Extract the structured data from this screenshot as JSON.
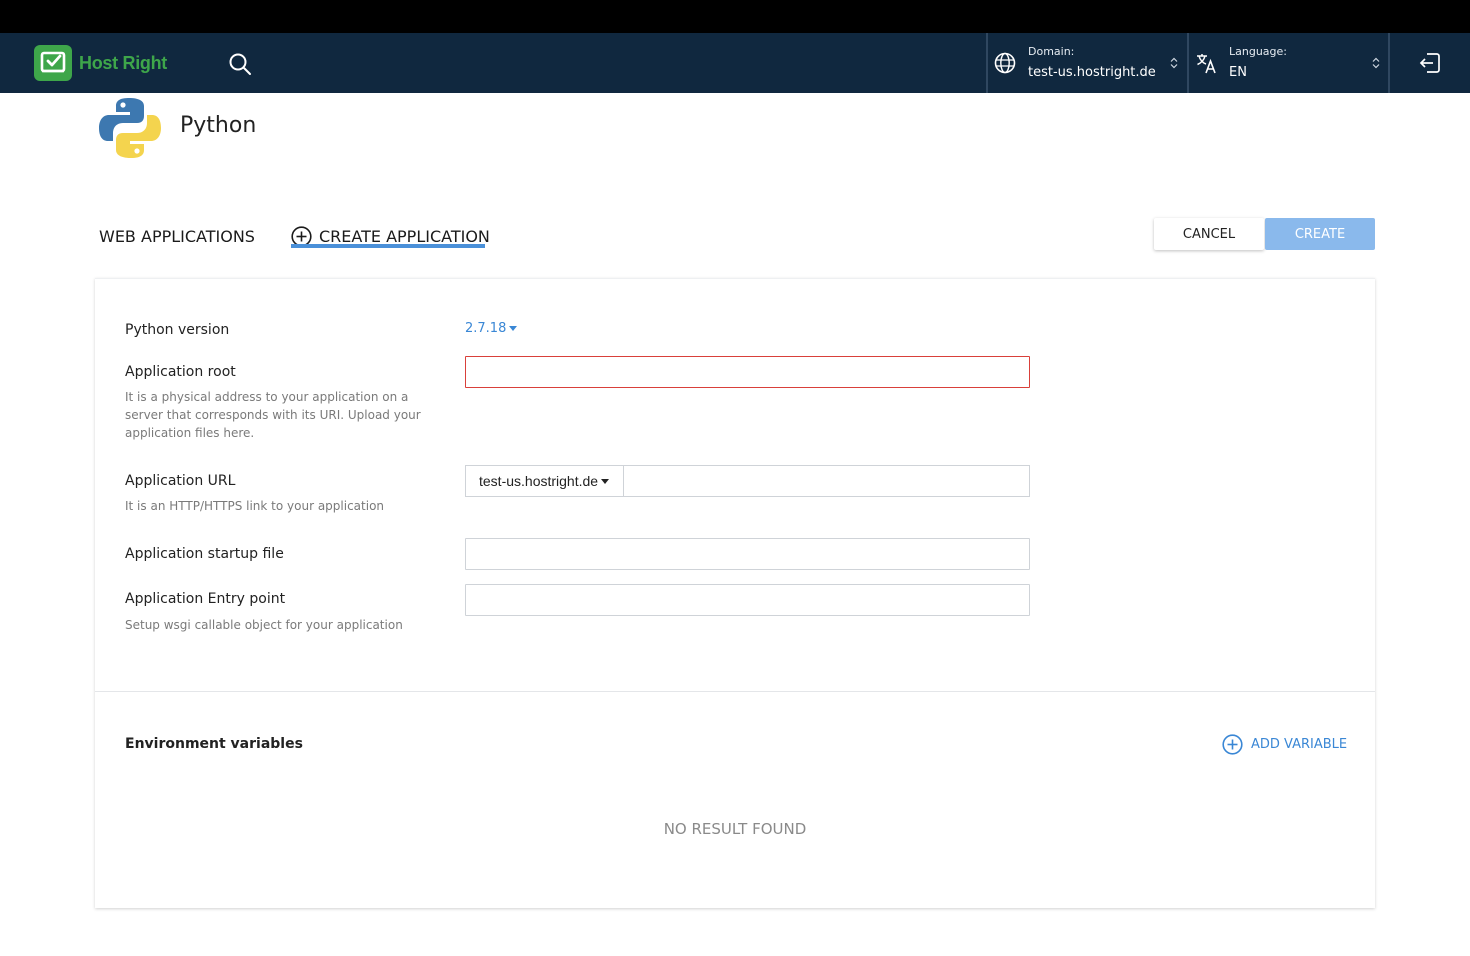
{
  "colors": {
    "navbar": "#10283f",
    "brand_green": "#3ea64a",
    "accent_blue": "#3a87d5",
    "create_button": "#8ab9ec",
    "error_border": "#d9403a"
  },
  "navbar": {
    "brand_name": "Host Right",
    "search_icon": "search-icon",
    "domain": {
      "label": "Domain:",
      "value": "test-us.hostright.de",
      "icon": "globe-icon"
    },
    "language": {
      "label": "Language:",
      "value": "EN",
      "icon": "translate-icon"
    },
    "logout_icon": "logout-icon"
  },
  "page": {
    "title": "Python",
    "icon": "python-logo-icon"
  },
  "tabs": [
    {
      "label": "WEB APPLICATIONS",
      "active": false
    },
    {
      "label": "CREATE APPLICATION",
      "active": true,
      "icon": "plus-circle-icon"
    }
  ],
  "actions": {
    "cancel_label": "CANCEL",
    "create_label": "CREATE"
  },
  "form": {
    "python_version": {
      "label": "Python version",
      "value": "2.7.18"
    },
    "app_root": {
      "label": "Application root",
      "help": "It is a physical address to your application on a server that corresponds with its URI. Upload your application files here.",
      "value": ""
    },
    "app_url": {
      "label": "Application URL",
      "help": "It is an HTTP/HTTPS link to your application",
      "domain": "test-us.hostright.de",
      "value": ""
    },
    "startup_file": {
      "label": "Application startup file",
      "value": ""
    },
    "entry_point": {
      "label": "Application Entry point",
      "help": "Setup wsgi callable object for your application",
      "value": ""
    }
  },
  "env": {
    "title": "Environment variables",
    "add_label": "ADD VARIABLE",
    "empty_text": "NO RESULT FOUND"
  }
}
